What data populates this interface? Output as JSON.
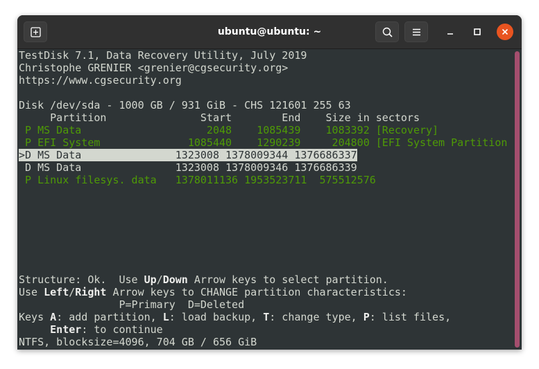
{
  "window": {
    "title": "ubuntu@ubuntu: ~"
  },
  "header": {
    "new_tab_icon": "new-tab-icon",
    "search_icon": "search-icon",
    "menu_icon": "hamburger-menu-icon",
    "minimize_icon": "minimize-icon",
    "maximize_icon": "maximize-icon",
    "close_icon": "close-icon"
  },
  "colors": {
    "terminal_bg": "#2e3436",
    "terminal_fg": "#d3d7cf",
    "green": "#4e9a06",
    "close_button": "#e95420",
    "scrollbar": "#a44e6e"
  },
  "terminal": {
    "banner": [
      "TestDisk 7.1, Data Recovery Utility, July 2019",
      "Christophe GRENIER <grenier@cgsecurity.org>",
      "https://www.cgsecurity.org"
    ],
    "disk_info": "Disk /dev/sda - 1000 GB / 931 GiB - CHS 121601 255 63",
    "table_header": "     Partition               Start        End    Size in sectors",
    "partitions": [
      {
        "line": " P MS Data                    2048    1085439    1083392 [Recovery]",
        "style": "green"
      },
      {
        "line": " P EFI System              1085440    1290239     204800 [EFI System Partition",
        "style": "green"
      },
      {
        "line": ">D MS Data               1323008 1378009344 1376686337",
        "style": "selected"
      },
      {
        "line": " D MS Data               1323008 1378009346 1376686339",
        "style": "normal"
      },
      {
        "line": " P Linux filesys. data   1378011136 1953523711  575512576",
        "style": "green"
      }
    ],
    "help": {
      "line1_a": "Structure: Ok.  Use ",
      "line1_b": "Up",
      "line1_c": "/",
      "line1_d": "Down",
      "line1_e": " Arrow keys to select partition.",
      "line2_a": "Use ",
      "line2_b": "Left",
      "line2_c": "/",
      "line2_d": "Right",
      "line2_e": " Arrow keys to CHANGE partition characteristics:",
      "line3": "                P=Primary  D=Deleted",
      "line4_a": "Keys ",
      "line4_b": "A",
      "line4_c": ": add partition, ",
      "line4_d": "L",
      "line4_e": ": load backup, ",
      "line4_f": "T",
      "line4_g": ": change type, ",
      "line4_h": "P",
      "line4_i": ": list files,",
      "line5_a": "     ",
      "line5_b": "Enter",
      "line5_c": ": to continue",
      "line6": "NTFS, blocksize=4096, 704 GB / 656 GiB"
    }
  }
}
